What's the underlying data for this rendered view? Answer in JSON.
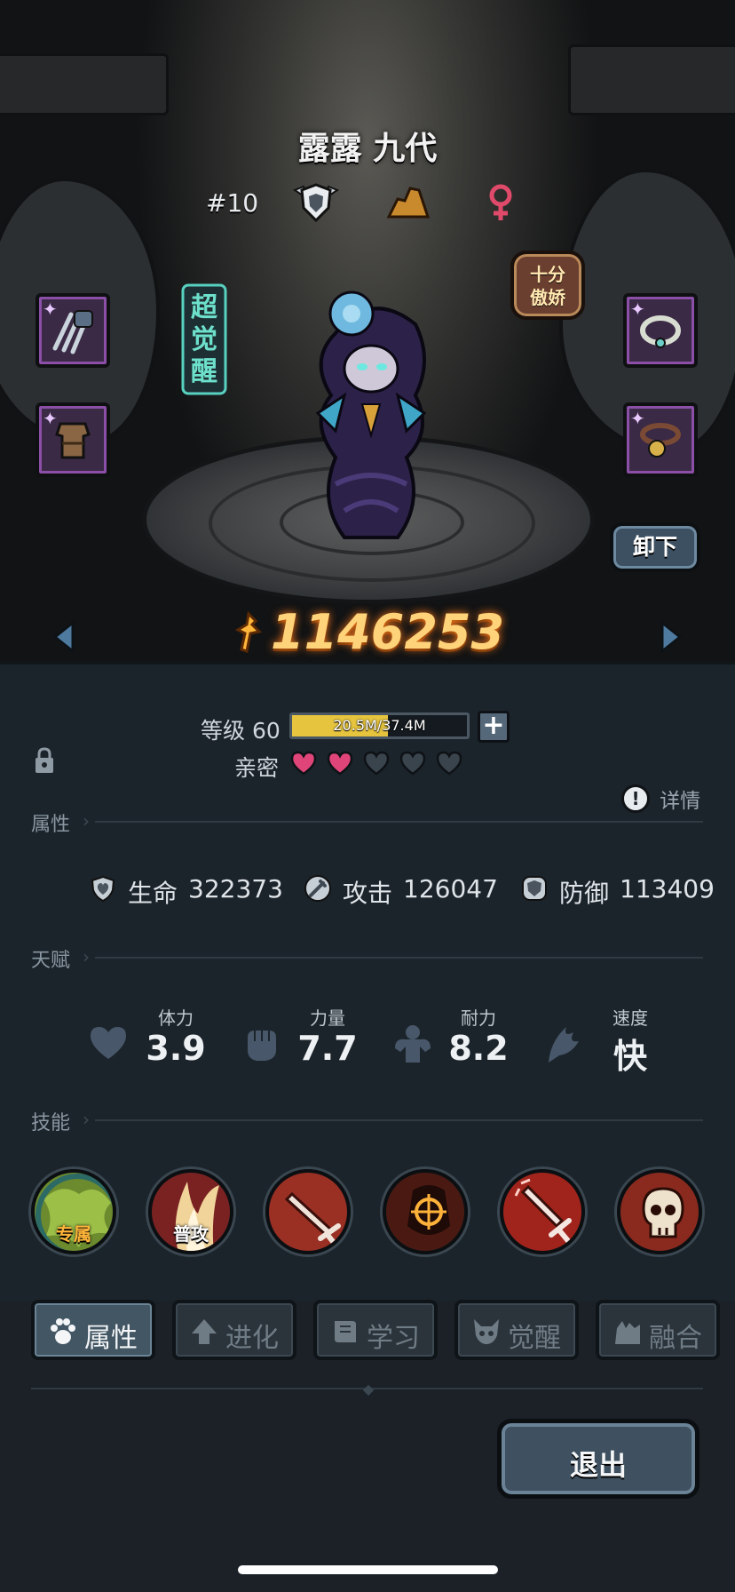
{
  "hero": {
    "name": "露露 九代",
    "rank": "#10",
    "awaken_badge": "超觉醒",
    "trait_badge_line1": "十分",
    "trait_badge_line2": "傲娇",
    "power": "1146253",
    "meta_icons": [
      "shield-rank-icon",
      "terrain-icon",
      "female-icon"
    ]
  },
  "scene": {
    "unequip_label": "卸下",
    "equipment": [
      "claw-weapon-icon",
      "leather-armor-icon",
      "pearl-necklace-icon",
      "bell-collar-icon"
    ]
  },
  "progress": {
    "level_label": "等级 60",
    "xp_text": "20.5M/37.4M",
    "xp_fraction": 0.548,
    "affinity_label": "亲密",
    "hearts_filled": 2,
    "hearts_total": 5
  },
  "details_label": "详情",
  "sections": {
    "attributes": "属性",
    "talents": "天赋",
    "skills": "技能"
  },
  "stats": [
    {
      "name": "生命",
      "value": "322373",
      "icon": "heart-shield-icon"
    },
    {
      "name": "攻击",
      "value": "126047",
      "icon": "sword-icon"
    },
    {
      "name": "防御",
      "value": "113409",
      "icon": "armor-icon"
    }
  ],
  "talents": [
    {
      "name": "体力",
      "value": "3.9",
      "icon": "heart-icon"
    },
    {
      "name": "力量",
      "value": "7.7",
      "icon": "fist-icon"
    },
    {
      "name": "耐力",
      "value": "8.2",
      "icon": "muscle-icon"
    },
    {
      "name": "速度",
      "value": "快",
      "icon": "wing-icon"
    }
  ],
  "skills": [
    {
      "tag": "专属",
      "icon": "exclusive-skill-icon"
    },
    {
      "tag": "普攻",
      "icon": "basic-attack-icon"
    },
    {
      "tag": "",
      "icon": "sword-strike-icon"
    },
    {
      "tag": "",
      "icon": "target-icon"
    },
    {
      "tag": "",
      "icon": "shattered-sword-icon"
    },
    {
      "tag": "",
      "icon": "skull-icon"
    }
  ],
  "tabs": [
    {
      "label": "属性",
      "active": true
    },
    {
      "label": "进化",
      "active": false
    },
    {
      "label": "学习",
      "active": false
    },
    {
      "label": "觉醒",
      "active": false
    },
    {
      "label": "融合",
      "active": false
    }
  ],
  "exit_label": "退出",
  "colors": {
    "power": "#ffd37a",
    "heart_filled": "#e0457a",
    "xp_fill": "#e6c43e",
    "panel": "#1c242b",
    "equip_border": "#8b4fa8"
  }
}
